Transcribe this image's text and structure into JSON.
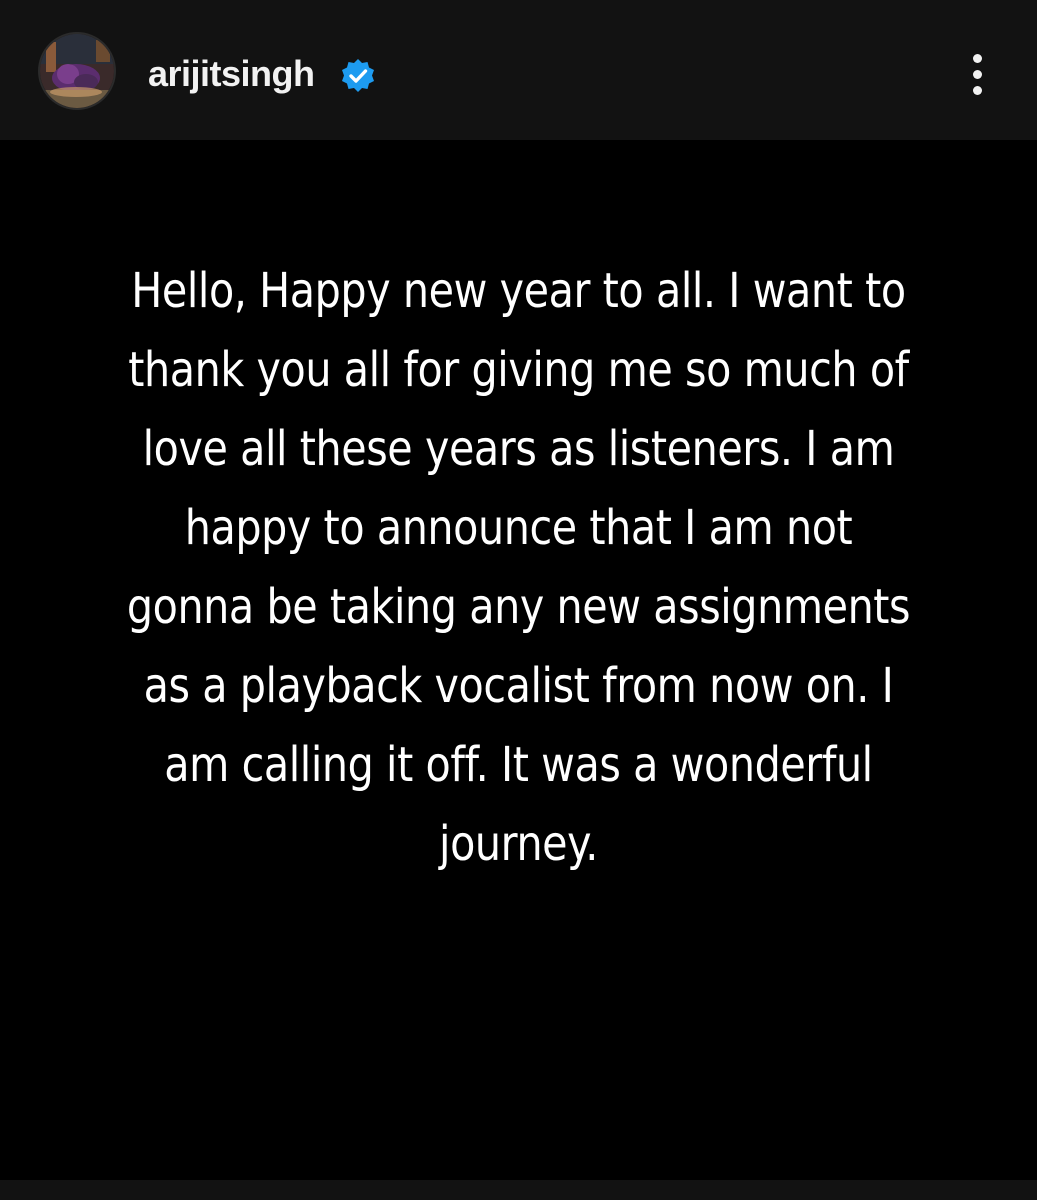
{
  "header": {
    "username": "arijitsingh",
    "avatar_icon": "profile-photo-avatar",
    "verified_icon": "verified-badge-icon",
    "more_icon": "more-options-icon"
  },
  "post": {
    "text": "Hello, Happy new year to all. I want to thank you all for giving me so much of love all these years as listeners. I am happy to announce that I am not gonna be taking any new assignments as a playback vocalist from now on. I am calling it off. It was a wonderful journey."
  },
  "colors": {
    "header_background": "#121212",
    "post_background": "#000000",
    "text": "#ffffff",
    "verified_badge": "#1d9bf0"
  }
}
